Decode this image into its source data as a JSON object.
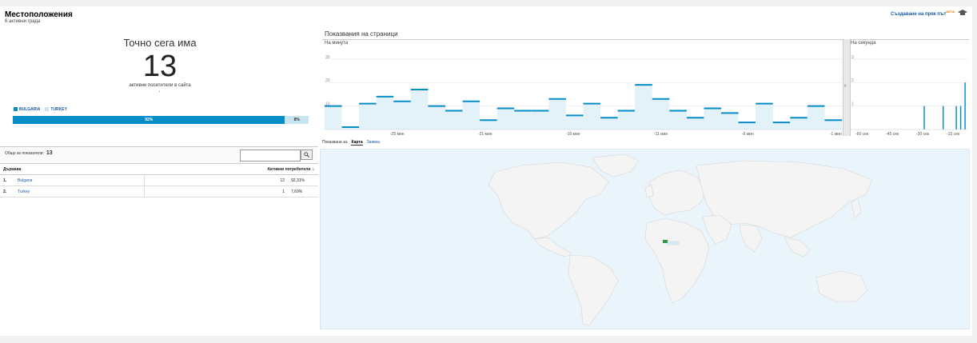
{
  "header": {
    "title": "Местоположения",
    "subtitle": "6 активни града",
    "shortcut_label": "Създаване на пряк път",
    "beta": "БЕТА",
    "shortcut_icon": "graduation-cap-icon"
  },
  "now": {
    "label": "Точно сега има",
    "count": "13",
    "sub": "активни посетители в сайта"
  },
  "legend": [
    {
      "label": "BULGARIA",
      "color": "#058dc7"
    },
    {
      "label": "TURKEY",
      "color": "#c7e4f0"
    }
  ],
  "split": {
    "a_label": "92%",
    "a_value": 92,
    "b_label": "8%",
    "b_value": 8
  },
  "table": {
    "total_label": "Общо за показатели:",
    "total_value": "13",
    "search_icon": "magnifier-icon",
    "headers": {
      "country": "Държава",
      "active": "Активни потребители"
    },
    "rows": [
      {
        "idx": "1.",
        "country": "Bulgaria",
        "count": "12",
        "pct": "92,31%"
      },
      {
        "idx": "2.",
        "country": "Turkey",
        "count": "1",
        "pct": "7,69%"
      }
    ]
  },
  "pageviews": {
    "title": "Показвания на страници",
    "per_minute_label": "На минута",
    "per_second_label": "На секунда"
  },
  "chart_data": [
    {
      "type": "bar",
      "title": "На минута",
      "y_ticks": [
        "30",
        "20",
        "10"
      ],
      "ylim": [
        0,
        34
      ],
      "x_tick_labels": [
        "-25 мин",
        "-21 мин",
        "-16 мин",
        "-11 мин",
        "-6 мин",
        "-1 мин"
      ],
      "values": [
        10,
        1,
        11,
        14,
        12,
        17,
        10,
        8,
        12,
        4,
        9,
        8,
        8,
        13,
        6,
        11,
        5,
        8,
        19,
        13,
        8,
        5,
        9,
        7,
        3,
        11,
        3,
        5,
        10,
        4
      ]
    },
    {
      "type": "bar",
      "title": "На секунда",
      "y_ticks": [
        "3",
        "2",
        "1"
      ],
      "ylim": [
        0,
        3.4
      ],
      "x_tick_labels": [
        "-60 сек",
        "-45 сек",
        "-30 сек",
        "-15 сек"
      ],
      "values": [
        0,
        0,
        0,
        0,
        0,
        0,
        0,
        0,
        0,
        0,
        0,
        0,
        0,
        0,
        0,
        0,
        0,
        0,
        0,
        0,
        0,
        0,
        0,
        0,
        0,
        0,
        0,
        0,
        0,
        0,
        0,
        0,
        0,
        0,
        0,
        0,
        0,
        0,
        0,
        0,
        0,
        0,
        0,
        0,
        0,
        0,
        0,
        0,
        0,
        0,
        1,
        0,
        0,
        0,
        0,
        0,
        0,
        0,
        0,
        0,
        0,
        0,
        0,
        1,
        0,
        0,
        0,
        0,
        0,
        0,
        0,
        0,
        1,
        0,
        0,
        1,
        0,
        0,
        2,
        0
      ]
    }
  ],
  "view": {
    "label": "Показвани за:",
    "map_tab": "Карта",
    "list_tab": "Заявка"
  },
  "map": {
    "highlight_color": "#2e9a3e",
    "land_color": "#f4f4f4"
  }
}
